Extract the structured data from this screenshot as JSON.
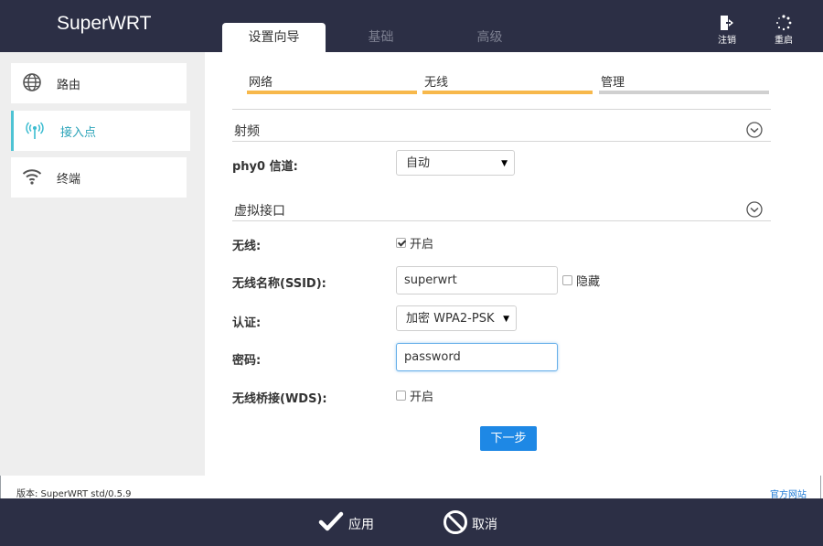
{
  "app": {
    "title": "SuperWRT"
  },
  "tabs": [
    {
      "label": "设置向导",
      "active": true
    },
    {
      "label": "基础",
      "active": false
    },
    {
      "label": "高级",
      "active": false
    }
  ],
  "header_actions": {
    "logout_label": "注销",
    "reboot_label": "重启"
  },
  "sidebar": {
    "items": [
      {
        "label": "路由",
        "icon": "globe-icon"
      },
      {
        "label": "接入点",
        "icon": "access-point-icon",
        "active": true
      },
      {
        "label": "终端",
        "icon": "wifi-icon"
      }
    ]
  },
  "steps": [
    {
      "label": "网络",
      "done": true
    },
    {
      "label": "无线",
      "done": true
    },
    {
      "label": "管理",
      "done": false
    }
  ],
  "radio_section": {
    "title": "射频",
    "channel_label": "phy0 信道:",
    "channel_value": "自动"
  },
  "vif_section": {
    "title": "虚拟接口",
    "wireless_label": "无线:",
    "wireless_enable_label": "开启",
    "wireless_enabled": true,
    "ssid_label": "无线名称(SSID):",
    "ssid_value": "superwrt",
    "hide_label": "隐藏",
    "hide_checked": false,
    "auth_label": "认证:",
    "auth_value": "加密 WPA2-PSK",
    "password_label": "密码:",
    "password_value": "password",
    "wds_label": "无线桥接(WDS):",
    "wds_enable_label": "开启",
    "wds_enabled": false
  },
  "next_button": "下一步",
  "footer": {
    "version": "版本: SuperWRT std/0.5.9",
    "official_site": "官方网站",
    "apply_label": "应用",
    "cancel_label": "取消"
  },
  "colors": {
    "header_bg": "#2c2f45",
    "step_active": "#f7b84b",
    "step_inactive": "#d0d0d0",
    "sidebar_active": "#4ec3d4",
    "primary_button": "#1e88e5",
    "link": "#1e7ad6"
  }
}
